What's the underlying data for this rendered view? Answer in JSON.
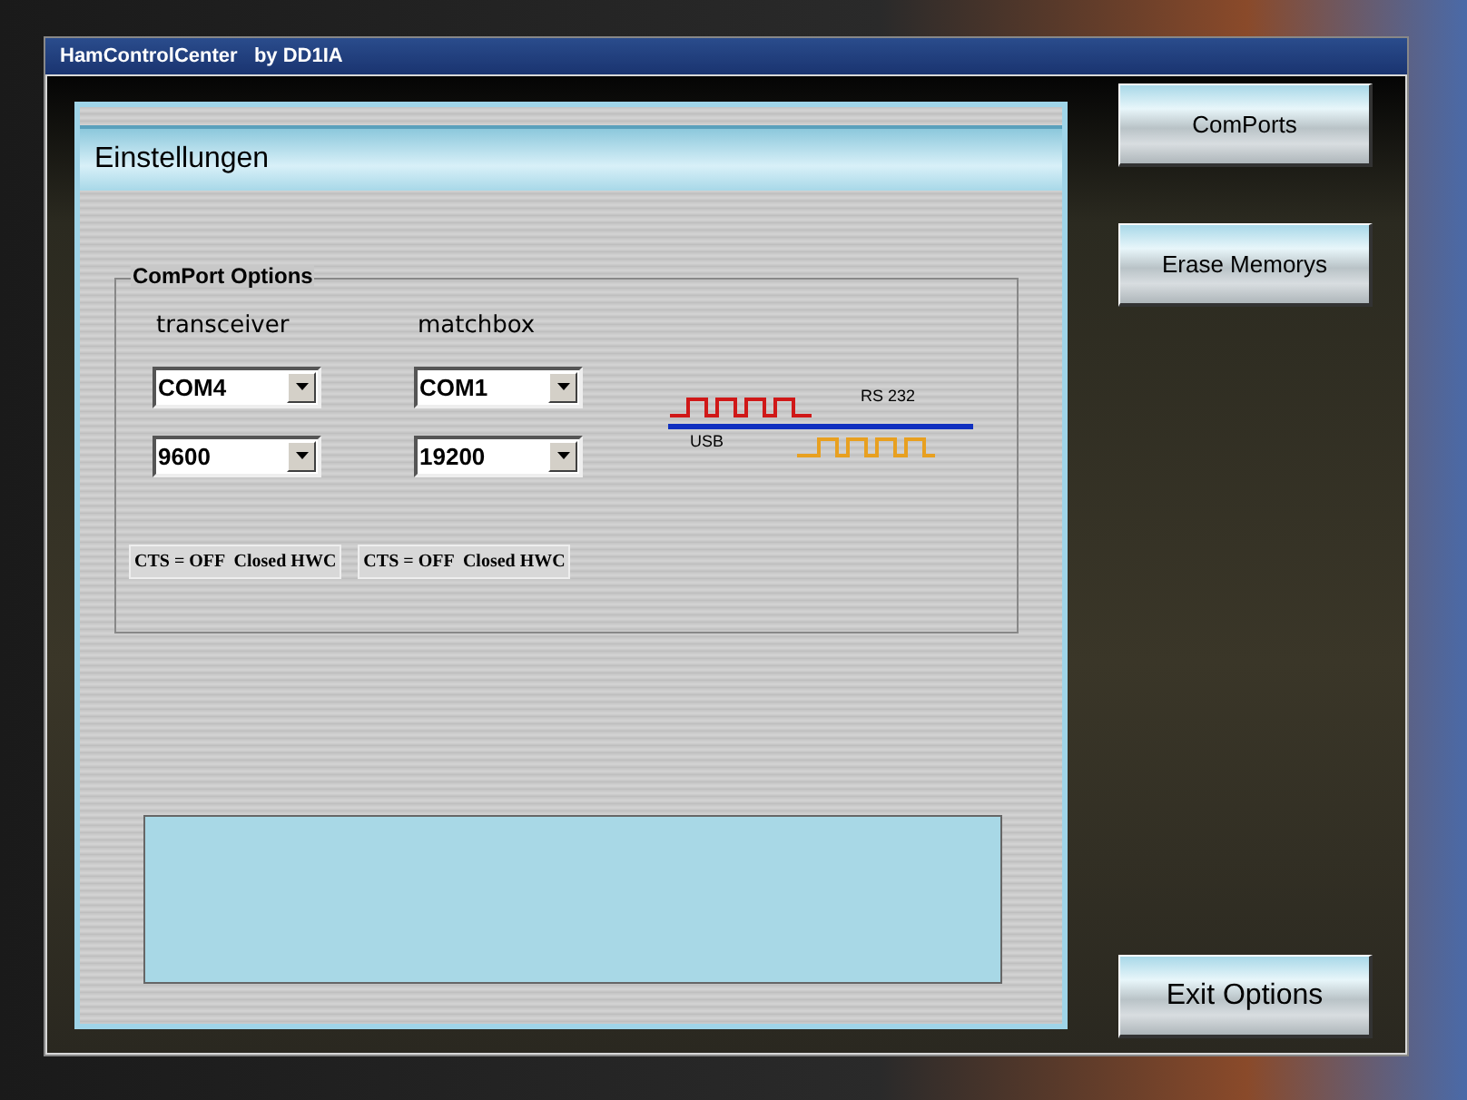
{
  "window": {
    "title": "HamControlCenter   by DD1IA"
  },
  "panel": {
    "title": "Einstellungen"
  },
  "comport_options": {
    "title": "ComPort Options",
    "columns": [
      {
        "label": "transceiver",
        "port": "COM4",
        "baud": "9600",
        "status": "CTS = OFF  Closed HWC"
      },
      {
        "label": "matchbox",
        "port": "COM1",
        "baud": "19200",
        "status": "CTS = OFF  Closed HWC"
      }
    ],
    "diagram": {
      "rs232_label": "RS 232",
      "usb_label": "USB"
    }
  },
  "side_buttons": [
    {
      "label": "ComPorts"
    },
    {
      "label": "Erase Memorys"
    }
  ],
  "exit_button": {
    "label": "Exit Options"
  }
}
